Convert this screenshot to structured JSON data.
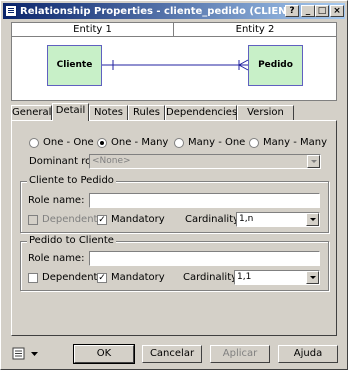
{
  "window": {
    "title": "Relationship Properties - cliente_pedido (CLIENTE_PEDID...",
    "controls": {
      "help": "?",
      "minimize": "_",
      "maximize": "□",
      "close": "×"
    }
  },
  "diagram": {
    "entity1_header": "Entity 1",
    "entity2_header": "Entity 2",
    "entity1_name": "Cliente",
    "entity2_name": "Pedido"
  },
  "tabs": [
    "General",
    "Detail",
    "Notes",
    "Rules",
    "Dependencies",
    "Version Info"
  ],
  "active_tab": "Detail",
  "cardinality_options": [
    "One - One",
    "One - Many",
    "Many - One",
    "Many - Many"
  ],
  "cardinality_selected": "One - Many",
  "dominant_role": {
    "label": "Dominant role:",
    "value": "<None>"
  },
  "group1": {
    "title": "Cliente to Pedido",
    "role_name_label": "Role name:",
    "role_name_value": "",
    "dependent_label": "Dependent",
    "dependent_checked": false,
    "dependent_enabled": false,
    "mandatory_label": "Mandatory",
    "mandatory_checked": true,
    "cardinality_label": "Cardinality:",
    "cardinality_value": "1,n"
  },
  "group2": {
    "title": "Pedido to Cliente",
    "role_name_label": "Role name:",
    "role_name_value": "",
    "dependent_label": "Dependent",
    "dependent_checked": false,
    "dependent_enabled": true,
    "mandatory_label": "Mandatory",
    "mandatory_checked": true,
    "cardinality_label": "Cardinality:",
    "cardinality_value": "1,1"
  },
  "buttons": {
    "ok": "OK",
    "cancel": "Cancelar",
    "apply": "Aplicar",
    "help": "Ajuda"
  },
  "colors": {
    "titlebar_start": "#0a246a",
    "titlebar_end": "#a6caf0",
    "entity_fill": "#c8f0c8",
    "relationship_line": "#2020a0"
  }
}
